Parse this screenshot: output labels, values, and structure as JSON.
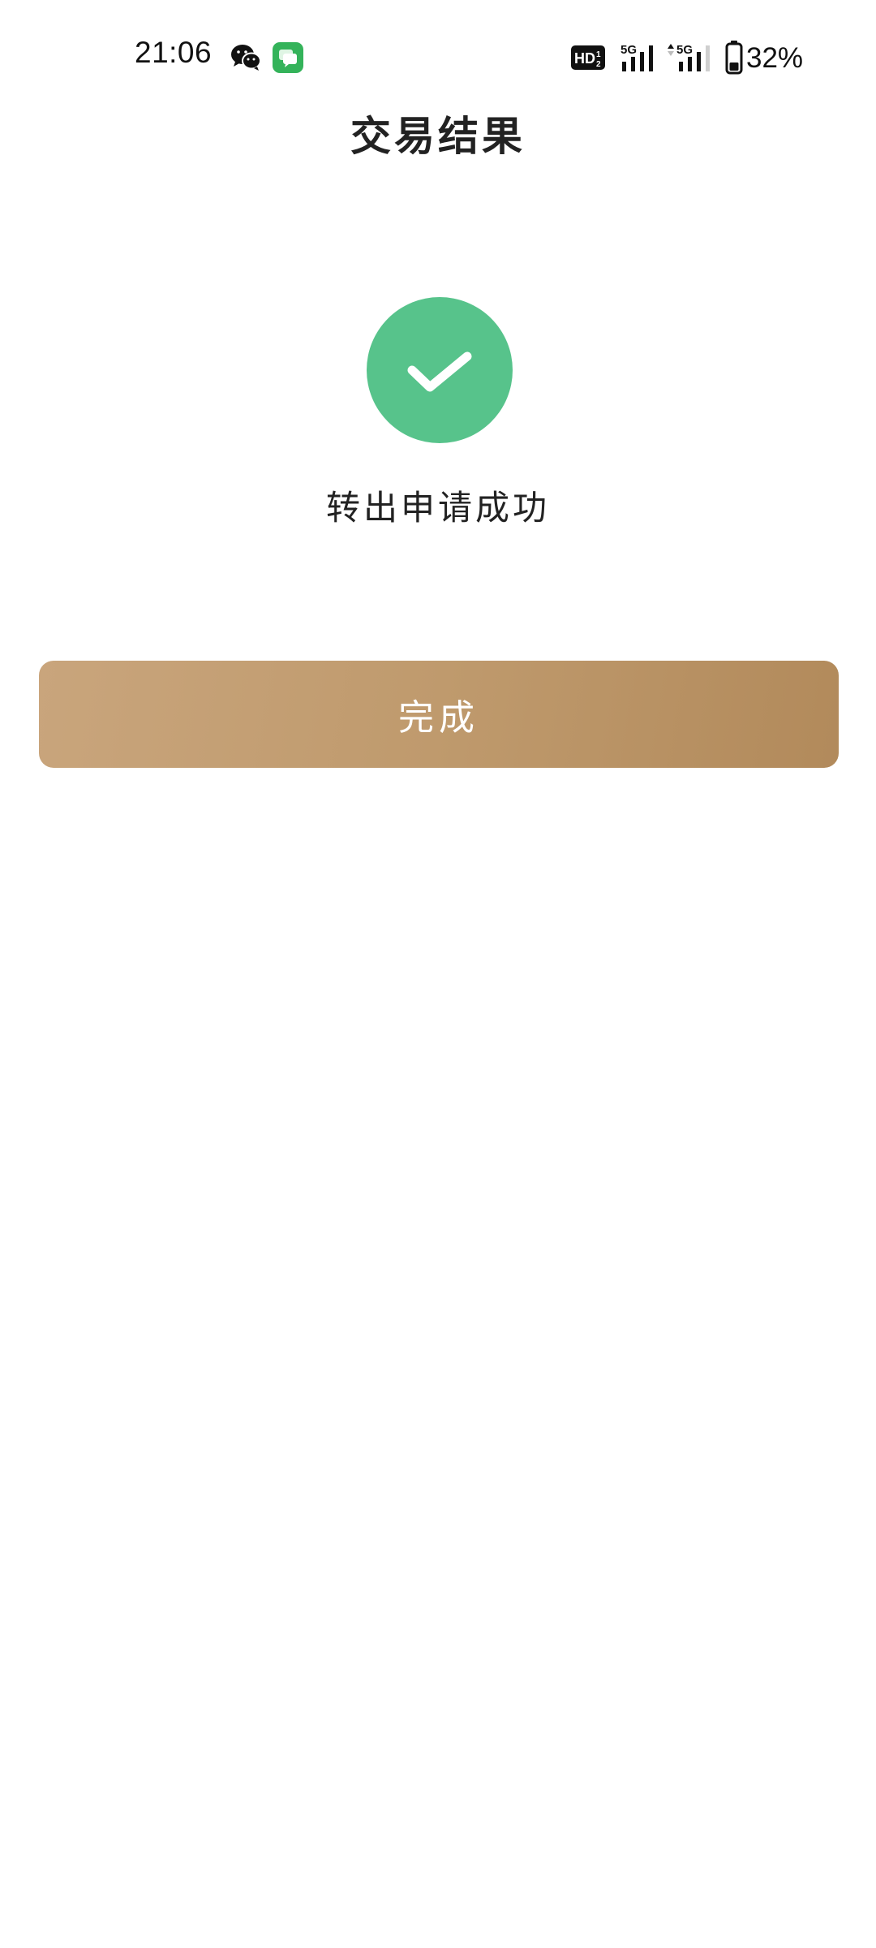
{
  "status_bar": {
    "time": "21:06",
    "battery_percent": "32%",
    "network_1": "5G",
    "network_2": "5G",
    "hd_badge": "HD",
    "icons": [
      "wechat-icon",
      "messages-app-icon",
      "hd-voice-icon",
      "signal-5g-icon",
      "signal-5g-icon",
      "battery-icon"
    ]
  },
  "header": {
    "title": "交易结果"
  },
  "result": {
    "icon": "check-circle-icon",
    "message": "转出申请成功"
  },
  "actions": {
    "done_label": "完成"
  },
  "colors": {
    "success_green": "#57c38b",
    "button_gradient_start": "#c9a57c",
    "button_gradient_end": "#b28a5b",
    "text_dark": "#222222"
  }
}
